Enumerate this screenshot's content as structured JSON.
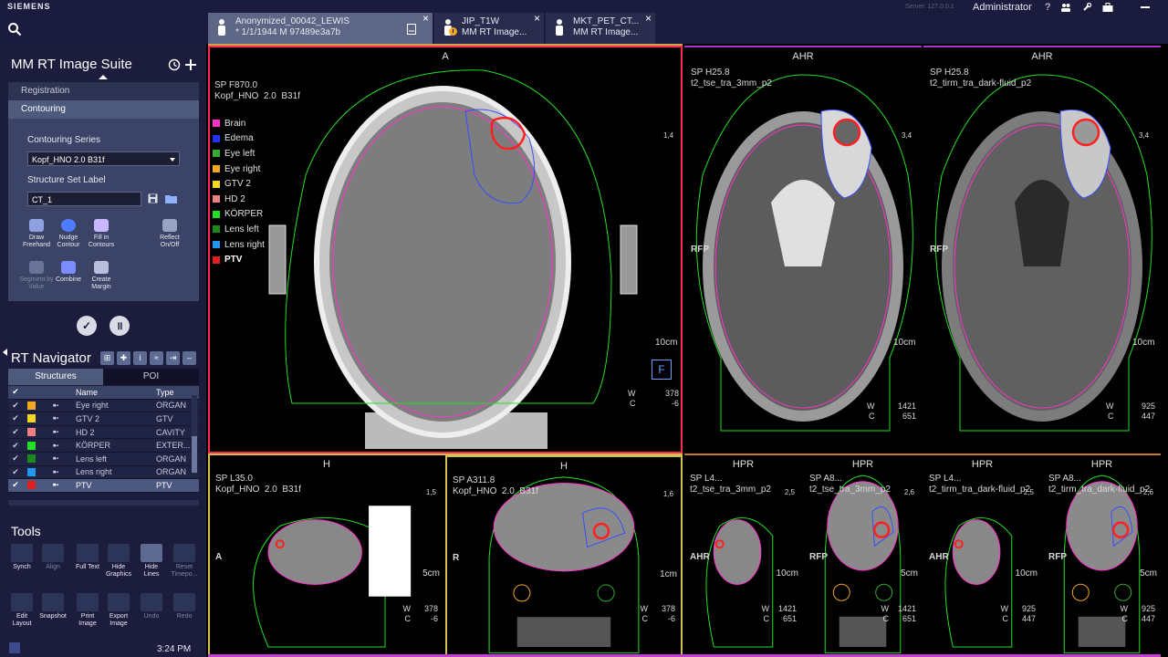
{
  "topbar": {
    "brand": "SIEMENS",
    "server": "Server: 127.0.0.1",
    "user": "Administrator",
    "tabs": [
      {
        "line1": "Anonymized_00042_LEWIS",
        "line2": "* 1/1/1944 M 97489e3a7b"
      },
      {
        "line1": "JIP_T1W",
        "line2": "MM RT Image..."
      },
      {
        "line1": "MKT_PET_CT...",
        "line2": "MM RT Image..."
      }
    ],
    "help": "?",
    "close_x": "×"
  },
  "left": {
    "suite_title": "MM RT Image Suite",
    "menu": [
      "Registration",
      "Contouring"
    ],
    "contouring_series_label": "Contouring Series",
    "contouring_series_value": "Kopf_HNO  2.0  B31f",
    "structure_set_label": "Structure Set Label",
    "structure_set_value": "CT_1",
    "tools": [
      {
        "label": "Draw Freehand",
        "name": "draw-freehand"
      },
      {
        "label": "Nudge Contour",
        "name": "nudge-contour"
      },
      {
        "label": "Fill in Contours",
        "name": "fill-in-contours"
      },
      {
        "label": "Reflect On/Off",
        "name": "reflect-onoff"
      },
      {
        "label": "Segment by Value",
        "name": "segment-by-value"
      },
      {
        "label": "Combine",
        "name": "combine"
      },
      {
        "label": "Create Margin",
        "name": "create-margin"
      }
    ],
    "navigator_title": "RT Navigator",
    "nav_tabs": [
      "Structures",
      "POI"
    ],
    "table_headers": {
      "name": "Name",
      "type": "Type"
    },
    "structures": [
      {
        "name": "Eye right",
        "type": "ORGAN",
        "color": "#f5a623"
      },
      {
        "name": "GTV 2",
        "type": "GTV",
        "color": "#f5d623"
      },
      {
        "name": "HD 2",
        "type": "CAVITY",
        "color": "#f08080"
      },
      {
        "name": "KÖRPER",
        "type": "EXTER...",
        "color": "#22e022"
      },
      {
        "name": "Lens left",
        "type": "ORGAN",
        "color": "#1a8a1a"
      },
      {
        "name": "Lens right",
        "type": "ORGAN",
        "color": "#2196f3"
      },
      {
        "name": "PTV",
        "type": "PTV",
        "color": "#e02020"
      }
    ],
    "tools_title": "Tools",
    "view_tools": [
      {
        "label": "Synch",
        "name": "synch"
      },
      {
        "label": "Align",
        "name": "align"
      },
      {
        "label": "Full Text",
        "name": "full-text"
      },
      {
        "label": "Hide Graphics",
        "name": "hide-graphics"
      },
      {
        "label": "Hide Lines",
        "name": "hide-lines"
      },
      {
        "label": "Reset Timepo...",
        "name": "reset-timepoint"
      },
      {
        "label": "Edit Layout",
        "name": "edit-layout"
      },
      {
        "label": "Snapshot",
        "name": "snapshot"
      },
      {
        "label": "Print Image",
        "name": "print-image"
      },
      {
        "label": "Export Image",
        "name": "export-image"
      },
      {
        "label": "Undo",
        "name": "undo"
      },
      {
        "label": "Redo",
        "name": "redo"
      }
    ],
    "clock": "3:24 PM"
  },
  "legend": [
    {
      "name": "Brain",
      "color": "#ff33cc"
    },
    {
      "name": "Edema",
      "color": "#2233ee"
    },
    {
      "name": "Eye left",
      "color": "#33aa33"
    },
    {
      "name": "Eye right",
      "color": "#f5a623"
    },
    {
      "name": "GTV 2",
      "color": "#f5d623"
    },
    {
      "name": "HD 2",
      "color": "#f08080"
    },
    {
      "name": "KÖRPER",
      "color": "#22e022"
    },
    {
      "name": "Lens left",
      "color": "#1a8a1a"
    },
    {
      "name": "Lens right",
      "color": "#2196f3"
    },
    {
      "name": "PTV",
      "color": "#e02020"
    }
  ],
  "viewports": {
    "main": {
      "orient": "A",
      "info": "SP F870.0\nKopf_HNO  2.0  B31f",
      "scale": "10cm",
      "zoom": "1,4",
      "w": "378",
      "c": "-6",
      "wlabel": "W",
      "clabel": "C",
      "left_tag": "",
      "frame": "F"
    },
    "t2": {
      "orient": "AHR",
      "info": "SP H25.8\nt2_tse_tra_3mm_p2",
      "scale": "10cm",
      "zoom": "3,4",
      "w": "1421",
      "c": "651",
      "rfp": "RFP"
    },
    "flair": {
      "orient": "AHR",
      "info": "SP H25.8\nt2_tirm_tra_dark-fluid_p2",
      "scale": "10cm",
      "zoom": "3,4",
      "w": "925",
      "c": "447",
      "rfp": "RFP"
    },
    "sag_ct": {
      "orient": "H",
      "info": "SP L35.0\nKopf_HNO  2.0  B31f",
      "scale": "5cm",
      "zoom": "1,5",
      "w": "378",
      "c": "-6",
      "side": "A"
    },
    "cor_ct": {
      "orient": "H",
      "info": "SP A311.8\nKopf_HNO  2.0  B31f",
      "scale": "1cm",
      "zoom": "1,6",
      "w": "378",
      "c": "-6",
      "side": "R"
    },
    "sag_t2": {
      "orient": "HPR",
      "info": "SP L4...\nt2_tse_tra_3mm_p2",
      "scale": "10cm",
      "zoom": "2,5",
      "w": "1421",
      "c": "651",
      "side": "AHR"
    },
    "cor_t2": {
      "orient": "HPR",
      "info": "SP A8...\nt2_tse_tra_3mm_p2",
      "scale": "5cm",
      "zoom": "2,6",
      "w": "1421",
      "c": "651",
      "side": "RFP"
    },
    "sag_fl": {
      "orient": "HPR",
      "info": "SP L4...\nt2_tirm_tra_dark-fluid_p2",
      "scale": "10cm",
      "zoom": "2,5",
      "w": "925",
      "c": "447",
      "side": "AHR"
    },
    "cor_fl": {
      "orient": "HPR",
      "info": "SP A8...\nt2_tirm_tra_dark-fluid_p2",
      "scale": "5cm",
      "zoom": "2,6",
      "w": "925",
      "c": "447",
      "side": "RFP"
    }
  }
}
